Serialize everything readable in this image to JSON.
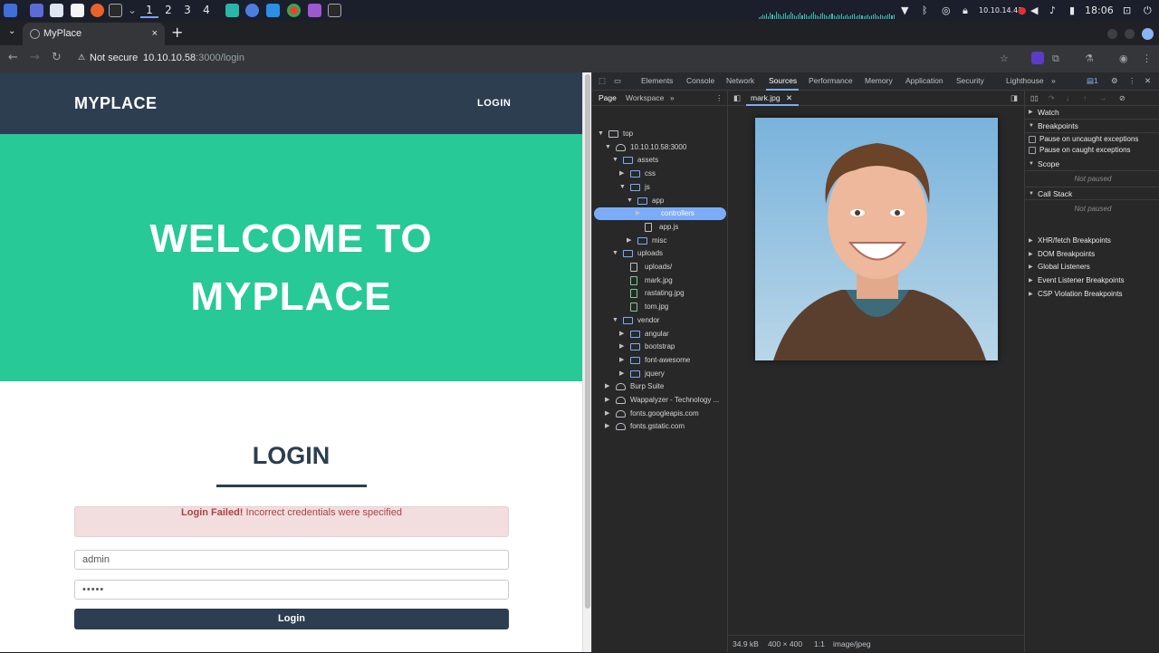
{
  "os": {
    "workspaces": [
      "1",
      "2",
      "3",
      "4"
    ],
    "ip": "10.10.14.43",
    "clock": "18:06",
    "graph_levels": [
      2,
      3,
      5,
      4,
      6,
      3,
      7,
      5,
      4,
      8,
      6,
      5,
      3,
      6,
      7,
      4,
      5,
      8,
      6,
      4,
      3,
      5,
      7,
      4,
      6,
      5,
      3,
      4,
      6,
      8,
      5,
      4,
      3,
      6,
      7,
      5,
      4,
      3,
      5,
      6,
      4,
      3,
      5,
      4,
      6,
      3,
      4,
      5,
      3,
      4,
      5,
      6,
      3,
      4,
      5,
      4,
      3,
      4,
      5,
      3,
      4,
      5,
      6,
      4,
      3,
      5,
      4,
      3,
      4,
      5,
      6,
      4,
      5
    ]
  },
  "browser": {
    "tab_title": "MyPlace",
    "tab_close": "×",
    "new_tab": "+",
    "security_label": "Not secure",
    "url_host": "10.10.10.58",
    "url_rest": ":3000/login",
    "url_full_host": "10.10.10.58",
    "url_full_path": ":3000/login"
  },
  "site": {
    "brand": "MYPLACE",
    "nav_login": "LOGIN",
    "hero_line1": "WELCOME TO",
    "hero_line2": "MYPLACE",
    "login_title": "LOGIN",
    "alert_strong": "Login Failed!",
    "alert_text": " Incorrect credentials were specified",
    "username_value": "admin",
    "password_value": "•••••",
    "login_button": "Login"
  },
  "devtools": {
    "tabs": [
      "Elements",
      "Console",
      "Network",
      "Sources",
      "Performance",
      "Memory",
      "Application",
      "Security",
      "Lighthouse"
    ],
    "active_tab": "Sources",
    "issues_count": "1",
    "nav_subtabs": [
      "Page",
      "Workspace"
    ],
    "tree": [
      {
        "label": "top",
        "depth": 0,
        "type": "top",
        "open": true
      },
      {
        "label": "10.10.10.58:3000",
        "depth": 1,
        "type": "cloud",
        "open": true
      },
      {
        "label": "assets",
        "depth": 2,
        "type": "folder",
        "open": true
      },
      {
        "label": "css",
        "depth": 3,
        "type": "folder",
        "open": false
      },
      {
        "label": "js",
        "depth": 3,
        "type": "folder",
        "open": true
      },
      {
        "label": "app",
        "depth": 4,
        "type": "folder",
        "open": true
      },
      {
        "label": "controllers",
        "depth": 5,
        "type": "folder",
        "open": false,
        "selected": true
      },
      {
        "label": "app.js",
        "depth": 5,
        "type": "file"
      },
      {
        "label": "misc",
        "depth": 4,
        "type": "folder",
        "open": false
      },
      {
        "label": "uploads",
        "depth": 2,
        "type": "folder",
        "open": true
      },
      {
        "label": "uploads/",
        "depth": 3,
        "type": "file"
      },
      {
        "label": "mark.jpg",
        "depth": 3,
        "type": "img"
      },
      {
        "label": "rastating.jpg",
        "depth": 3,
        "type": "img"
      },
      {
        "label": "tom.jpg",
        "depth": 3,
        "type": "img"
      },
      {
        "label": "vendor",
        "depth": 2,
        "type": "folder",
        "open": true
      },
      {
        "label": "angular",
        "depth": 3,
        "type": "folder",
        "open": false
      },
      {
        "label": "bootstrap",
        "depth": 3,
        "type": "folder",
        "open": false
      },
      {
        "label": "font-awesome",
        "depth": 3,
        "type": "folder",
        "open": false
      },
      {
        "label": "jquery",
        "depth": 3,
        "type": "folder",
        "open": false
      },
      {
        "label": "Burp Suite",
        "depth": 1,
        "type": "cloud",
        "open": false
      },
      {
        "label": "Wappalyzer - Technology ...",
        "depth": 1,
        "type": "cloud",
        "open": false
      },
      {
        "label": "fonts.googleapis.com",
        "depth": 1,
        "type": "cloud",
        "open": false
      },
      {
        "label": "fonts.gstatic.com",
        "depth": 1,
        "type": "cloud",
        "open": false
      }
    ],
    "editor_tab": "mark.jpg",
    "status_size": "34.9 kB",
    "status_dims": "400 × 400",
    "status_ratio": "1:1",
    "status_type": "image/jpeg",
    "side": {
      "watch": "Watch",
      "breakpoints": "Breakpoints",
      "pause_uncaught": "Pause on uncaught exceptions",
      "pause_caught": "Pause on caught exceptions",
      "scope": "Scope",
      "not_paused": "Not paused",
      "call_stack": "Call Stack",
      "sections": [
        "XHR/fetch Breakpoints",
        "DOM Breakpoints",
        "Global Listeners",
        "Event Listener Breakpoints",
        "CSP Violation Breakpoints"
      ]
    }
  },
  "colors": {
    "nav_dark": "#2c3e50",
    "hero_green": "#27c996",
    "alert_bg": "#f2dede",
    "alert_text": "#a94442",
    "devtools_accent": "#7cacf8"
  }
}
